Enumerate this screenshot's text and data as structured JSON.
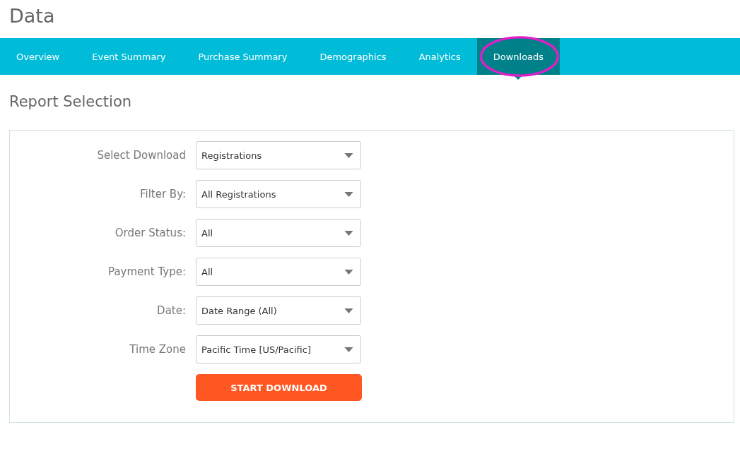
{
  "page_title": "Data",
  "tabs": [
    {
      "label": "Overview",
      "selected": false
    },
    {
      "label": "Event Summary",
      "selected": false
    },
    {
      "label": "Purchase Summary",
      "selected": false
    },
    {
      "label": "Demographics",
      "selected": false
    },
    {
      "label": "Analytics",
      "selected": false
    },
    {
      "label": "Downloads",
      "selected": true
    }
  ],
  "section_title": "Report Selection",
  "fields": [
    {
      "label": "Select Download",
      "value": "Registrations"
    },
    {
      "label": "Filter By:",
      "value": "All Registrations"
    },
    {
      "label": "Order Status:",
      "value": "All"
    },
    {
      "label": "Payment Type:",
      "value": "All"
    },
    {
      "label": "Date:",
      "value": "Date Range (All)"
    },
    {
      "label": "Time Zone",
      "value": "Pacific Time [US/Pacific]"
    }
  ],
  "button": "START DOWNLOAD"
}
